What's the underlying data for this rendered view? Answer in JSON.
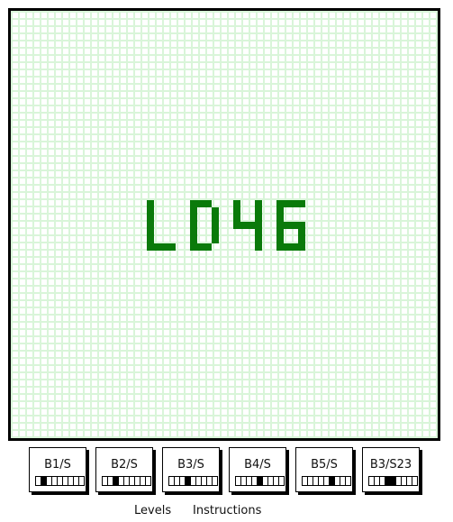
{
  "board": {
    "title": "LD46",
    "colors": {
      "alive": "#0a7a0a",
      "grid": "#d9f5d9",
      "background": "#ffffff",
      "border": "#000000"
    }
  },
  "rules": [
    {
      "label": "B1/S"
    },
    {
      "label": "B2/S"
    },
    {
      "label": "B3/S"
    },
    {
      "label": "B4/S"
    },
    {
      "label": "B5/S"
    },
    {
      "label": "B3/S23"
    }
  ],
  "links": {
    "levels": "Levels",
    "instructions": "Instructions"
  }
}
